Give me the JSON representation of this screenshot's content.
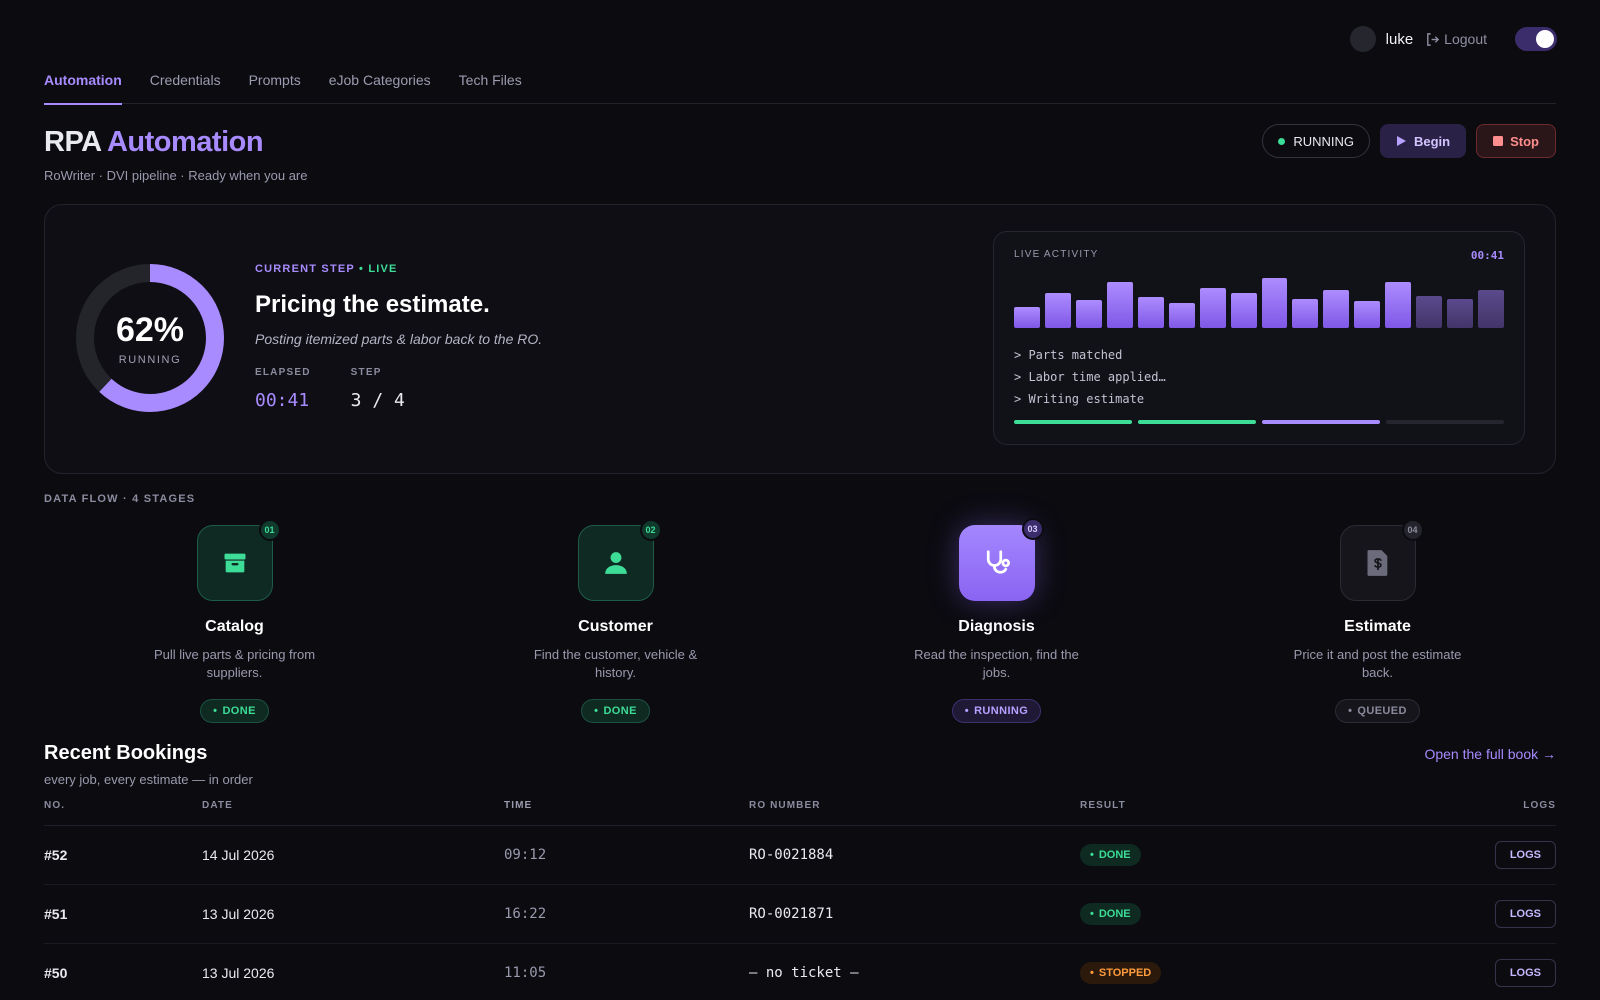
{
  "user": {
    "name": "luke",
    "logout_label": "Logout"
  },
  "tabs": [
    {
      "label": "Automation"
    },
    {
      "label": "Credentials"
    },
    {
      "label": "Prompts"
    },
    {
      "label": "eJob Categories"
    },
    {
      "label": "Tech Files"
    }
  ],
  "header": {
    "title_plain": "RPA",
    "title_accent": "Automation",
    "subtitle": "RoWriter · DVI pipeline · Ready when you are",
    "status_label": "RUNNING",
    "begin_label": "Begin",
    "stop_label": "Stop"
  },
  "current": {
    "progress_pct": 62,
    "progress_text": "62%",
    "progress_label": "RUNNING",
    "eyebrow": "CURRENT STEP",
    "live_label": "• LIVE",
    "title": "Pricing the estimate.",
    "description": "Posting itemized parts & labor back to the RO.",
    "elapsed_label": "ELAPSED",
    "elapsed_value": "00:41",
    "step_label": "STEP",
    "step_value": "3 / 4"
  },
  "activity": {
    "title": "LIVE ACTIVITY",
    "time": "00:41",
    "bars": [
      0.38,
      0.62,
      0.5,
      0.82,
      0.56,
      0.45,
      0.72,
      0.62,
      0.9,
      0.52,
      0.68,
      0.48,
      0.82,
      0.58,
      0.52,
      0.68
    ],
    "bars_active_count": 13,
    "lines": [
      "> Parts matched",
      "> Labor time applied…",
      "> Writing estimate"
    ],
    "segments": [
      "done",
      "done",
      "active",
      "pending"
    ]
  },
  "flow": {
    "label": "DATA FLOW · 4 STAGES",
    "stages": [
      {
        "num": "01",
        "name": "Catalog",
        "desc": "Pull live parts & pricing from suppliers.",
        "status": "done",
        "status_label": "DONE",
        "icon": "archive-icon"
      },
      {
        "num": "02",
        "name": "Customer",
        "desc": "Find the customer, vehicle & history.",
        "status": "done",
        "status_label": "DONE",
        "icon": "user-icon"
      },
      {
        "num": "03",
        "name": "Diagnosis",
        "desc": "Read the inspection, find the jobs.",
        "status": "running",
        "status_label": "RUNNING",
        "icon": "stethoscope-icon"
      },
      {
        "num": "04",
        "name": "Estimate",
        "desc": "Price it and post the estimate back.",
        "status": "queued",
        "status_label": "QUEUED",
        "icon": "invoice-icon"
      }
    ]
  },
  "bookings": {
    "title": "Recent Bookings",
    "subtitle": "every job, every estimate — in order",
    "link": "Open the full book →",
    "columns": [
      "NO.",
      "DATE",
      "TIME",
      "RO NUMBER",
      "RESULT",
      "LOGS"
    ],
    "rows": [
      {
        "no": "#52",
        "date": "14 Jul 2026",
        "time": "09:12",
        "ro": "RO-0021884",
        "result": "DONE",
        "result_type": "done",
        "logs": "LOGS"
      },
      {
        "no": "#51",
        "date": "13 Jul 2026",
        "time": "16:22",
        "ro": "RO-0021871",
        "result": "DONE",
        "result_type": "done",
        "logs": "LOGS"
      },
      {
        "no": "#50",
        "date": "13 Jul 2026",
        "time": "11:05",
        "ro": "— no ticket —",
        "result": "STOPPED",
        "result_type": "stopped",
        "logs": "LOGS"
      }
    ]
  },
  "colors": {
    "accent": "#a88bff",
    "success": "#3ddc97",
    "warning": "#ff9b3d",
    "danger": "#ff8e8e",
    "background": "#0b0b10"
  }
}
